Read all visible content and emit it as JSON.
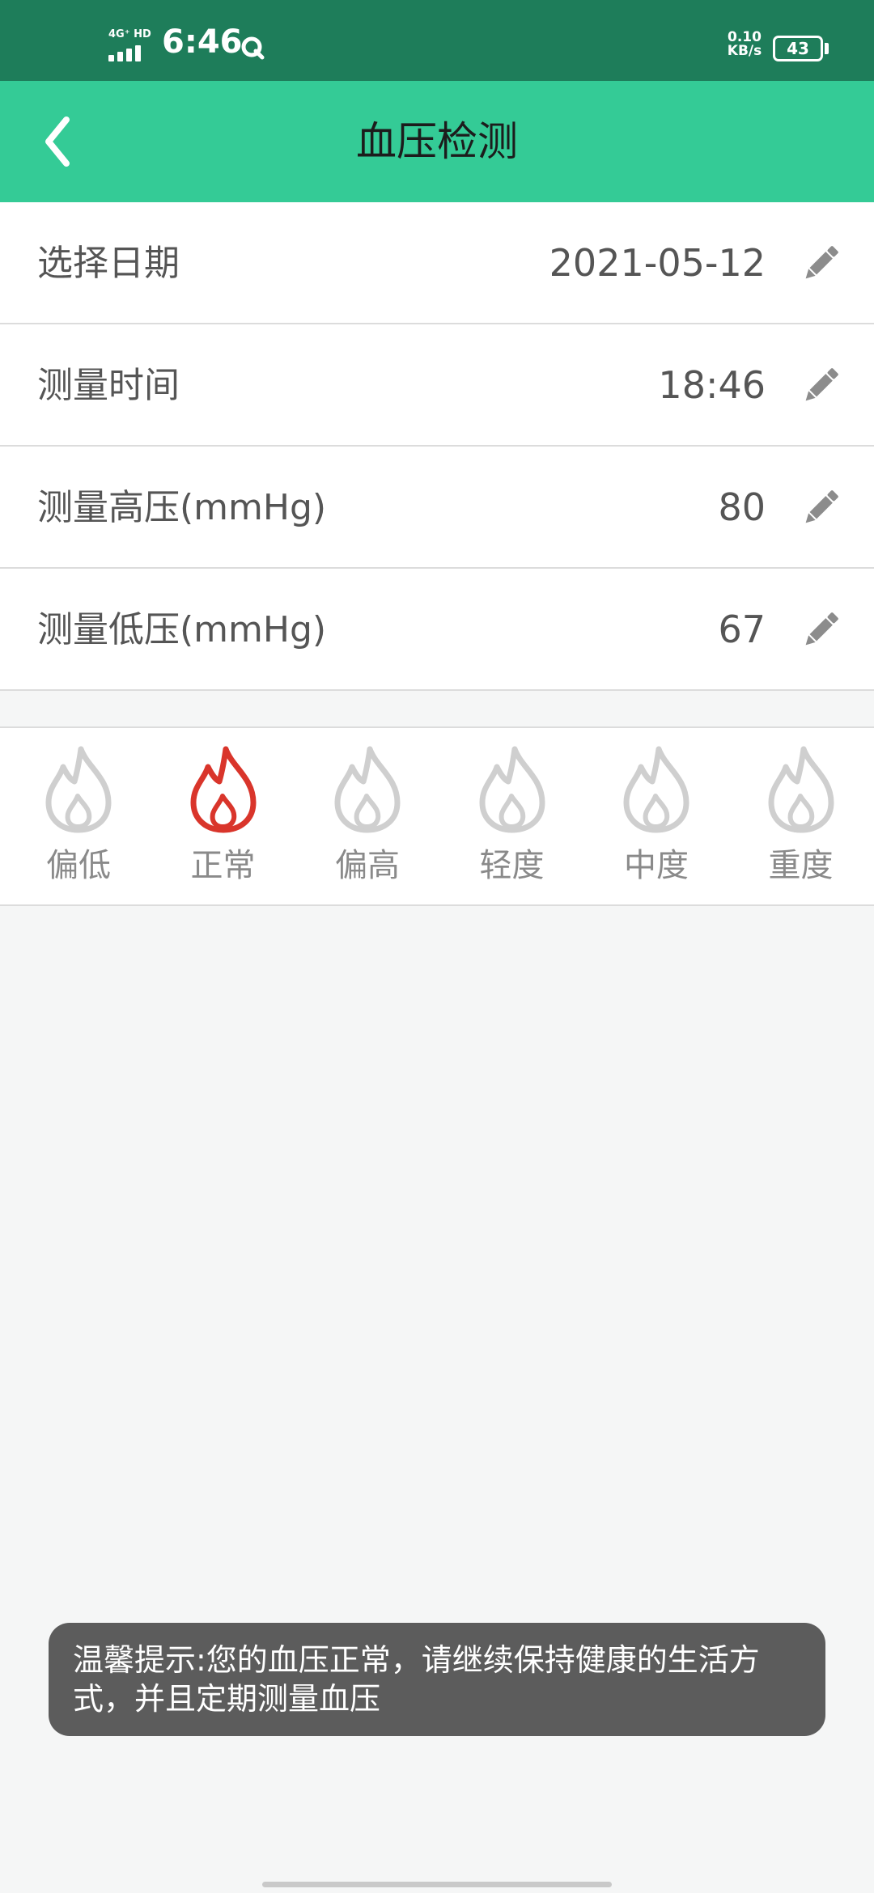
{
  "status_bar": {
    "network": "4G⁺ HD",
    "time": "6:46",
    "speed_value": "0.10",
    "speed_unit": "KB/s",
    "battery": "43"
  },
  "header": {
    "title": "血压检测",
    "back_icon": "chevron-left-icon"
  },
  "form": {
    "rows": [
      {
        "label": "选择日期",
        "value": "2021-05-12",
        "icon": "pencil-icon"
      },
      {
        "label": "测量时间",
        "value": "18:46",
        "icon": "pencil-icon"
      },
      {
        "label": "测量高压(mmHg)",
        "value": "80",
        "icon": "pencil-icon"
      },
      {
        "label": "测量低压(mmHg)",
        "value": "67",
        "icon": "pencil-icon"
      }
    ]
  },
  "levels": {
    "items": [
      {
        "label": "偏低",
        "active": false
      },
      {
        "label": "正常",
        "active": true
      },
      {
        "label": "偏高",
        "active": false
      },
      {
        "label": "轻度",
        "active": false
      },
      {
        "label": "中度",
        "active": false
      },
      {
        "label": "重度",
        "active": false
      }
    ],
    "icon": "flame-icon",
    "active_color": "#d9352b",
    "inactive_color": "#cfcfcf"
  },
  "toast": {
    "text": "温馨提示:您的血压正常，请继续保持健康的生活方式，并且定期测量血压"
  },
  "colors": {
    "status_bar": "#1e7d5a",
    "app_bar": "#34cb96",
    "toast_bg": "#5c5c5c"
  }
}
